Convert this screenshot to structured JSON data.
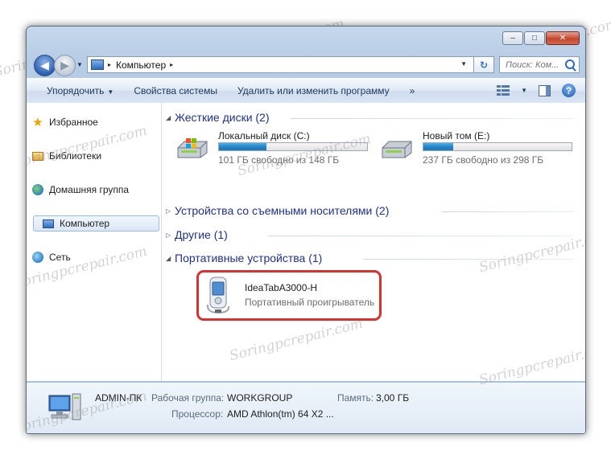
{
  "watermark_text": "Soringpcrepair.com",
  "window": {
    "caption_buttons": {
      "minimize": "–",
      "maximize": "□",
      "close": "✕"
    }
  },
  "address_bar": {
    "location": "Компьютер",
    "separator": "▸",
    "search_placeholder": "Поиск: Ком..."
  },
  "toolbar": {
    "organize": "Упорядочить",
    "system_properties": "Свойства системы",
    "uninstall": "Удалить или изменить программу",
    "more": "»"
  },
  "nav_pane": {
    "items": [
      {
        "label": "Избранное",
        "icon": "star-icon"
      },
      {
        "label": "Библиотеки",
        "icon": "libraries-icon"
      },
      {
        "label": "Домашняя группа",
        "icon": "homegroup-icon"
      },
      {
        "label": "Компьютер",
        "icon": "computer-icon",
        "selected": true
      },
      {
        "label": "Сеть",
        "icon": "network-icon"
      }
    ]
  },
  "content": {
    "groups": [
      {
        "title": "Жесткие диски (2)",
        "expanded": true
      },
      {
        "title": "Устройства со съемными носителями (2)",
        "expanded": false
      },
      {
        "title": "Другие (1)",
        "expanded": false
      },
      {
        "title": "Портативные устройства (1)",
        "expanded": true
      }
    ],
    "drives": [
      {
        "name": "Локальный диск (C:)",
        "free_text": "101 ГБ свободно из 148 ГБ",
        "used_fraction": 0.32
      },
      {
        "name": "Новый том (E:)",
        "free_text": "237 ГБ свободно из 298 ГБ",
        "used_fraction": 0.2
      }
    ],
    "portable_device": {
      "name": "IdeaTabA3000-H",
      "type": "Портативный проигрыватель",
      "highlight_color": "#d93030"
    }
  },
  "details": {
    "computer_name": "ADMIN-ПК",
    "workgroup_label": "Рабочая группа:",
    "workgroup_value": "WORKGROUP",
    "memory_label": "Память:",
    "memory_value": "3,00 ГБ",
    "cpu_label": "Процессор:",
    "cpu_value": "AMD Athlon(tm) 64 X2 ..."
  },
  "colors": {
    "accent": "#1e3287",
    "drive_bar": "#2586c8"
  }
}
